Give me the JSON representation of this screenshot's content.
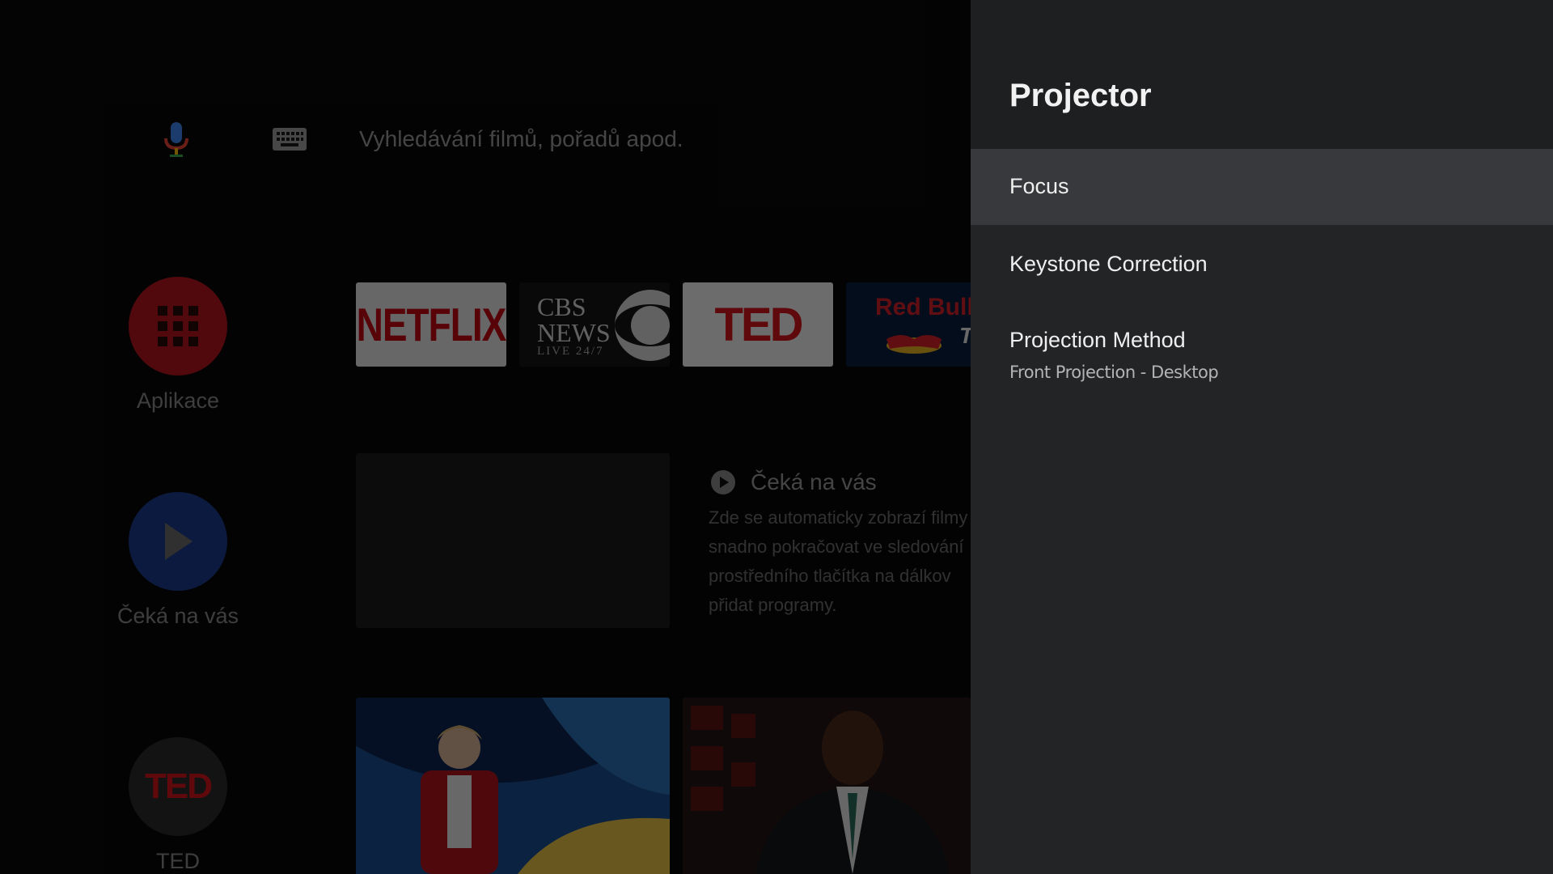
{
  "search": {
    "placeholder": "Vyhledávání filmů, pořadů apod.",
    "mic_icon": "mic-icon",
    "keyboard_icon": "keyboard-icon"
  },
  "sidebar": {
    "items": [
      {
        "label": "Aplikace",
        "icon": "apps-grid-icon",
        "color": "#b5151d"
      },
      {
        "label": "Čeká na vás",
        "icon": "play-icon",
        "color": "#1a3a8a"
      },
      {
        "label": "TED",
        "icon": "ted-logo",
        "color": "#2a2a2a"
      }
    ]
  },
  "apps_row": [
    {
      "name": "NETFLIX"
    },
    {
      "name": "CBS NEWS",
      "line1": "CBS",
      "line2": "NEWS",
      "line3": "LIVE 24/7"
    },
    {
      "name": "TED"
    },
    {
      "name": "Red Bull TV",
      "line1": "Red Bull",
      "line2": "TV"
    }
  ],
  "waiting": {
    "title": "Čeká na vás",
    "desc_lines": [
      "Zde se automaticky zobrazí filmy",
      "snadno pokračovat ve sledování",
      "prostředního tlačítka na dálkov",
      "přidat programy."
    ]
  },
  "panel": {
    "title": "Projector",
    "items": [
      {
        "label": "Focus",
        "focused": true
      },
      {
        "label": "Keystone Correction"
      },
      {
        "label": "Projection Method",
        "value": "Front Projection - Desktop"
      }
    ]
  },
  "colors": {
    "panel_bg": "#232426",
    "panel_header_bg": "#1e1f21",
    "focused_item_bg": "#38393c"
  }
}
